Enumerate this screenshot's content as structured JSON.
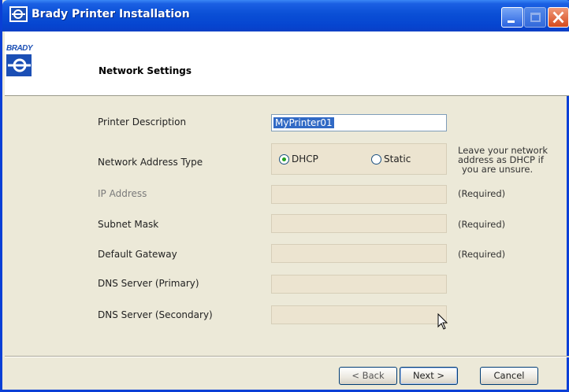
{
  "window": {
    "title": "Brady Printer Installation"
  },
  "header": {
    "logo_text": "BRADY",
    "title": "Network Settings"
  },
  "form": {
    "printer_description": {
      "label": "Printer Description",
      "value": "MyPrinter01"
    },
    "network_address_type": {
      "label": "Network Address Type",
      "options": [
        "DHCP",
        "Static"
      ],
      "selected": "DHCP",
      "note_lines": [
        "Leave your network",
        "address as DHCP if",
        "you are unsure."
      ]
    },
    "ip_address": {
      "label": "IP Address",
      "note": "(Required)"
    },
    "subnet_mask": {
      "label": "Subnet Mask",
      "note": "(Required)"
    },
    "default_gateway": {
      "label": "Default Gateway",
      "note": "(Required)"
    },
    "dns_primary": {
      "label": "DNS Server (Primary)"
    },
    "dns_secondary": {
      "label": "DNS Server (Secondary)"
    }
  },
  "buttons": {
    "back": "< Back",
    "next": "Next >",
    "cancel": "Cancel"
  },
  "colors": {
    "titlebar": "#0a4fd6",
    "accent": "#1b4fb5",
    "panel": "#ece9d8",
    "disabled_field": "#ece4d0"
  }
}
